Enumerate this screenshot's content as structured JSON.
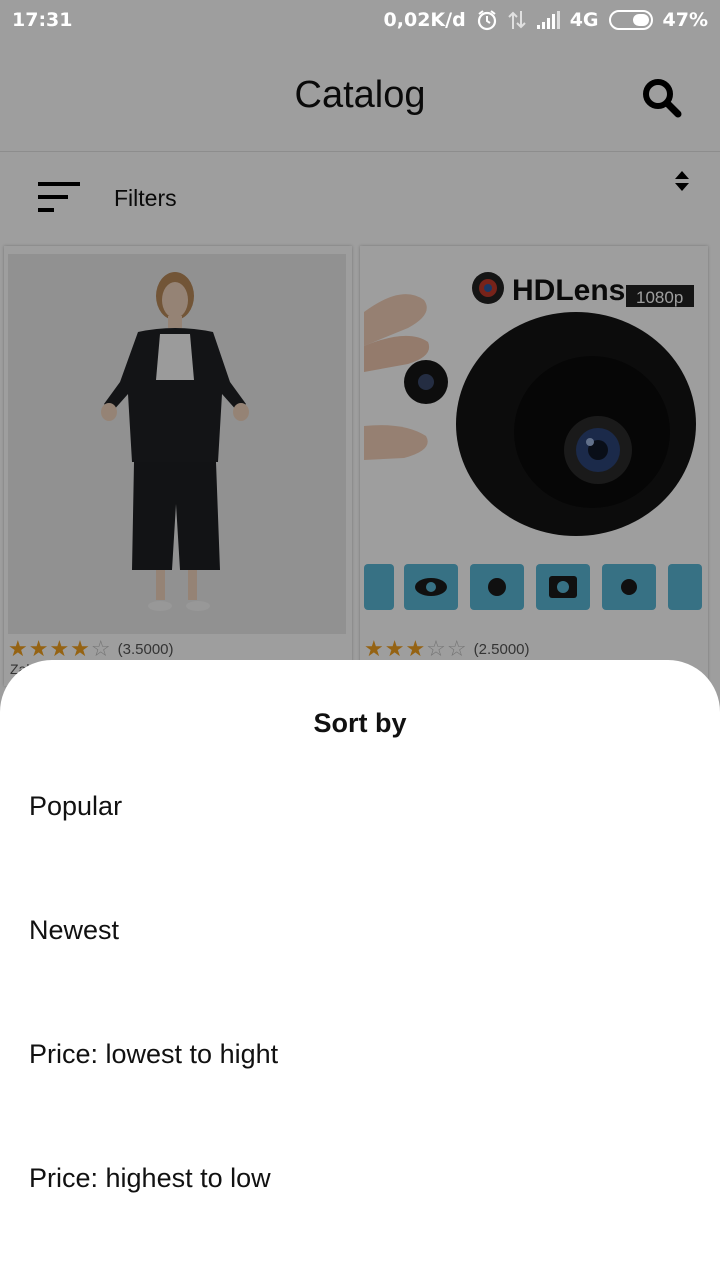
{
  "status_bar": {
    "time": "17:31",
    "network_speed": "0,02K/d",
    "network_type": "4G",
    "battery": "47%",
    "icons": [
      "alarm-icon",
      "data-transfer-icon",
      "signal-icon",
      "battery-icon"
    ]
  },
  "app_bar": {
    "title": "Catalog",
    "search_icon": "search-icon"
  },
  "filters": {
    "label": "Filters",
    "icon": "filter-lines-icon",
    "sort_icon": "sort-arrows-icon"
  },
  "products": [
    {
      "image": "woman-in-black-suit",
      "rating": 3.5,
      "rating_label": "(3.5000)",
      "name": "Zal"
    },
    {
      "image": "hd-lens-mini-camera",
      "brand_text": "HDLens",
      "resolution_badge": "1080p",
      "rating": 2.5,
      "rating_label": "(2.5000)"
    }
  ],
  "sort_sheet": {
    "title": "Sort by",
    "options": [
      "Popular",
      "Newest",
      "Price: lowest to hight",
      "Price: highest to low"
    ]
  },
  "colors": {
    "star": "#f0a020",
    "scrim": "rgba(0,0,0,0.38)",
    "status_bar": "#9e9e9e"
  }
}
